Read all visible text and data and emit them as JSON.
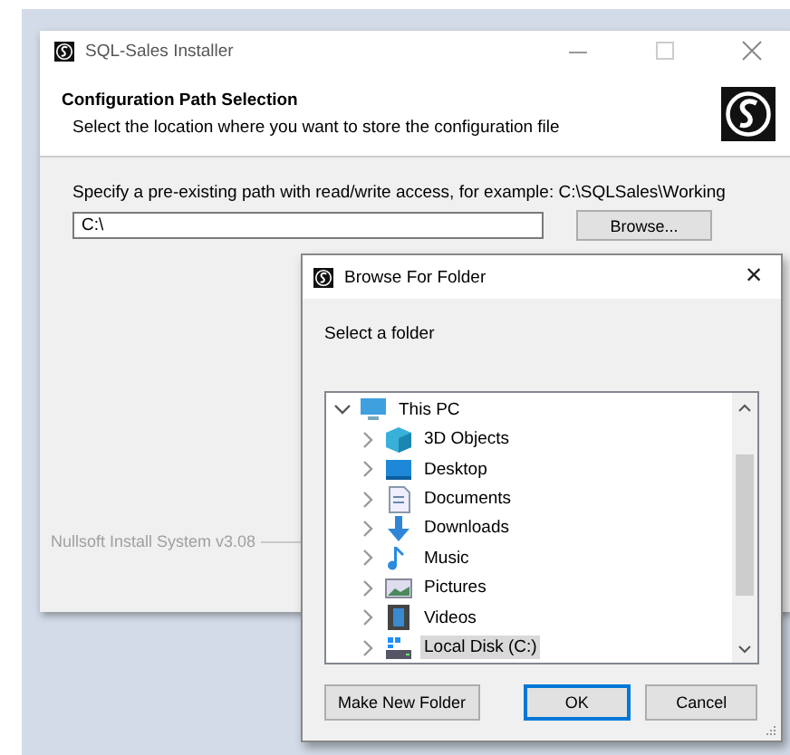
{
  "installer": {
    "title": "SQL-Sales Installer",
    "header_title": "Configuration Path Selection",
    "header_subtitle": "Select the location where you want to store the configuration file",
    "instruction": "Specify a pre-existing path with read/write access, for example: C:\\SQLSales\\Working",
    "path_value": "C:\\",
    "browse_button": "Browse...",
    "branding": "Nullsoft Install System v3.08"
  },
  "dialog": {
    "title": "Browse For Folder",
    "close": "×",
    "prompt": "Select a folder",
    "tree": [
      {
        "label": "This PC",
        "kind": "pc",
        "expanded": true,
        "selected": false,
        "children": [
          {
            "label": "3D Objects",
            "kind": "cube",
            "expanded": false,
            "selected": false
          },
          {
            "label": "Desktop",
            "kind": "desktop",
            "expanded": false,
            "selected": false
          },
          {
            "label": "Documents",
            "kind": "document",
            "expanded": false,
            "selected": false
          },
          {
            "label": "Downloads",
            "kind": "download",
            "expanded": false,
            "selected": false
          },
          {
            "label": "Music",
            "kind": "music",
            "expanded": false,
            "selected": false
          },
          {
            "label": "Pictures",
            "kind": "pictures",
            "expanded": false,
            "selected": false
          },
          {
            "label": "Videos",
            "kind": "video",
            "expanded": false,
            "selected": false
          },
          {
            "label": "Local Disk (C:)",
            "kind": "disk",
            "expanded": false,
            "selected": true
          }
        ]
      }
    ],
    "buttons": [
      {
        "label": "Make New Folder",
        "default": false
      },
      {
        "label": "OK",
        "default": true
      },
      {
        "label": "Cancel",
        "default": false
      }
    ]
  }
}
